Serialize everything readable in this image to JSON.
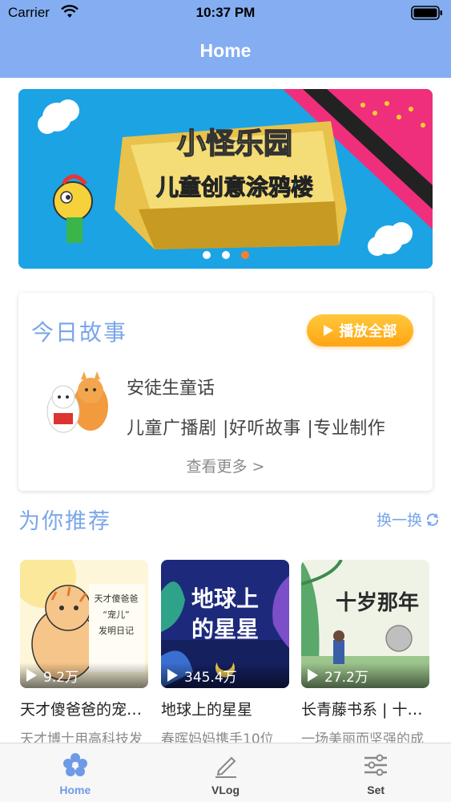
{
  "status_bar": {
    "carrier": "Carrier",
    "time": "10:37 PM"
  },
  "nav": {
    "title": "Home"
  },
  "banner": {
    "title_line1": "小怪乐园",
    "title_line2": "儿童创意涂鸦楼",
    "dots": 3,
    "active_dot": 2
  },
  "today": {
    "title": "今日故事",
    "play_all_label": "播放全部",
    "story_name": "安徒生童话",
    "story_tags": "儿童广播剧 |好听故事 |专业制作",
    "see_more": "查看更多 >"
  },
  "recommend": {
    "title": "为你推荐",
    "refresh_label": "换一换",
    "items": [
      {
        "plays": "9.2万",
        "name": "天才傻爸爸的宠…",
        "desc": "天才博士用高科技发",
        "cover_text": "天才傻爸爸“宠儿”发明日记"
      },
      {
        "plays": "345.4万",
        "name": "地球上的星星",
        "desc": "春晖妈妈携手10位",
        "cover_text": "地球上的星星"
      },
      {
        "plays": "27.2万",
        "name": "长青藤书系 | 十…",
        "desc": "一场美丽而坚强的成",
        "cover_text": "十岁那年"
      }
    ]
  },
  "tabbar": {
    "tabs": [
      {
        "label": "Home",
        "icon": "flower-icon",
        "active": true
      },
      {
        "label": "VLog",
        "icon": "pencil-icon",
        "active": false
      },
      {
        "label": "Set",
        "icon": "sliders-icon",
        "active": false
      }
    ]
  },
  "colors": {
    "header": "#84aef1",
    "accent": "#7aa6ea",
    "play_button": "#ffa514",
    "active_dot": "#ff7e2d"
  }
}
